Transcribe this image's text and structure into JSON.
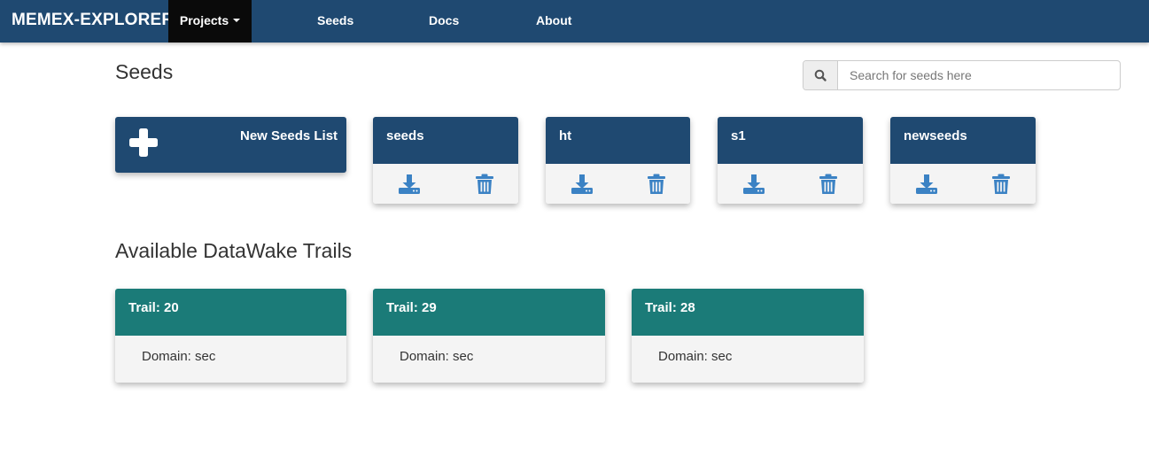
{
  "navbar": {
    "brand": "MEMEX-EXPLORER",
    "projects_label": "Projects",
    "links": [
      "Seeds",
      "Docs",
      "About"
    ]
  },
  "seeds_section": {
    "title": "Seeds",
    "search_placeholder": "Search for seeds here",
    "new_list_label": "New Seeds List",
    "lists": [
      {
        "name": "seeds"
      },
      {
        "name": "ht"
      },
      {
        "name": "s1"
      },
      {
        "name": "newseeds"
      }
    ]
  },
  "trails_section": {
    "title": "Available DataWake Trails",
    "trails": [
      {
        "label": "Trail: 20",
        "domain": "Domain: sec"
      },
      {
        "label": "Trail: 29",
        "domain": "Domain: sec"
      },
      {
        "label": "Trail: 28",
        "domain": "Domain: sec"
      }
    ]
  },
  "icons": {
    "search": "search-icon",
    "plus": "plus-icon",
    "download": "download-icon",
    "delete": "trash-icon",
    "caret": "caret-down-icon"
  },
  "colors": {
    "navbar_bg": "#1f4971",
    "active_nav_bg": "#0a0a0a",
    "seed_card_header": "#1f4971",
    "trail_card_header": "#1b7b78",
    "card_body": "#f4f4f4",
    "icon_blue": "#3b82c4"
  }
}
